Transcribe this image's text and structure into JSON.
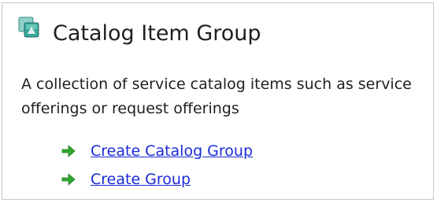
{
  "panel": {
    "title": "Catalog Item Group",
    "icon": "catalog-group-icon",
    "description": "A collection of service catalog items such as service offerings or request offerings",
    "tasks": [
      {
        "label": "Create Catalog Group",
        "icon": "green-arrow-icon"
      },
      {
        "label": "Create Group",
        "icon": "green-arrow-icon"
      }
    ]
  },
  "colors": {
    "link": "#1a2bd6",
    "arrow": "#2fa82f",
    "icon_teal": "#3aa79b",
    "border": "#c8c8c8"
  }
}
